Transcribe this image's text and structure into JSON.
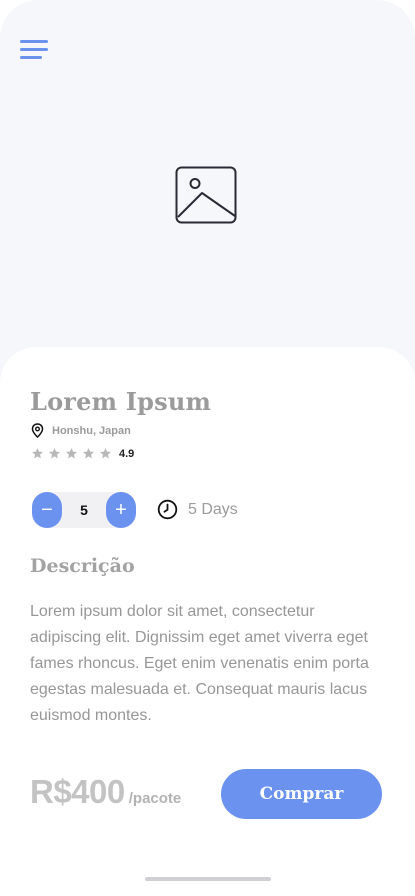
{
  "product": {
    "title": "Lorem Ipsum",
    "location": "Honshu, Japan",
    "rating": "4.9",
    "rating_stars": 5
  },
  "quantity": {
    "minus": "−",
    "value": "5",
    "plus": "+"
  },
  "duration": "5 Days",
  "description": {
    "heading": "Descrição",
    "body": "Lorem ipsum dolor sit amet, consectetur adipiscing elit. Dignissim eget amet viverra eget fames rhoncus. Eget enim venenatis enim porta egestas malesuada et. Consequat mauris lacus euismod montes."
  },
  "pricing": {
    "amount": "R$400",
    "unit": "/pacote",
    "buy_label": "Comprar"
  },
  "colors": {
    "accent": "#6a92ee",
    "header_background": "#f6f7fb",
    "muted_text": "#9b9b9b"
  },
  "icons": {
    "menu": "hamburger-icon",
    "image": "image-placeholder-icon",
    "location": "map-pin-icon",
    "star": "star-icon",
    "clock": "clock-icon"
  }
}
